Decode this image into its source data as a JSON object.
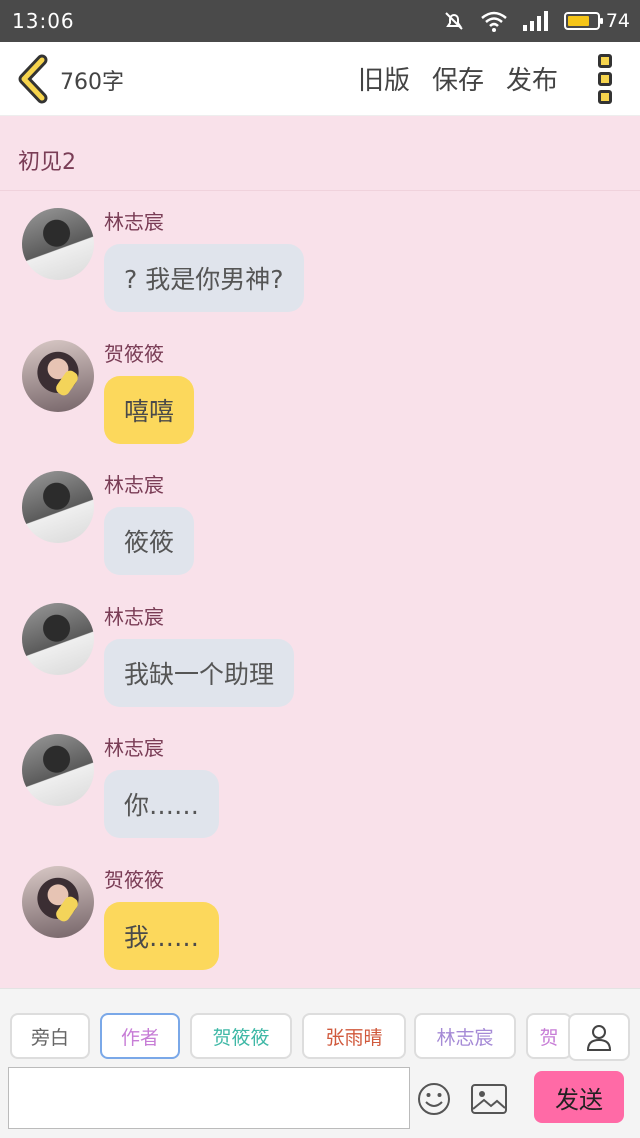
{
  "status_bar": {
    "time": "13:06",
    "battery_percent": "74",
    "battery_level": 0.74,
    "icons": [
      "mute-icon",
      "wifi-icon",
      "signal-icon",
      "battery-icon"
    ]
  },
  "header": {
    "word_count": "760字",
    "actions": {
      "old_version": "旧版",
      "save": "保存",
      "publish": "发布"
    },
    "icons": [
      "back-arrow-icon",
      "more-menu-icon"
    ]
  },
  "chat": {
    "chapter_title": "初见2",
    "messages": [
      {
        "speaker": "林志宸",
        "text": "? 我是你男神?",
        "role": "boy",
        "bubble_color": "#e0e4ec"
      },
      {
        "speaker": "贺筱筱",
        "text": "嘻嘻",
        "role": "girl",
        "bubble_color": "#fcd85c"
      },
      {
        "speaker": "林志宸",
        "text": "筱筱",
        "role": "boy",
        "bubble_color": "#e0e4ec"
      },
      {
        "speaker": "林志宸",
        "text": "我缺一个助理",
        "role": "boy",
        "bubble_color": "#e0e4ec"
      },
      {
        "speaker": "林志宸",
        "text": "你……",
        "role": "boy",
        "bubble_color": "#e0e4ec"
      },
      {
        "speaker": "贺筱筱",
        "text": "我……",
        "role": "girl",
        "bubble_color": "#fcd85c"
      }
    ]
  },
  "composer": {
    "roles": [
      {
        "label": "旁白",
        "color": "#666666"
      },
      {
        "label": "作者",
        "color": "#c77dd6",
        "selected": true
      },
      {
        "label": "贺筱筱",
        "color": "#3fb8a6"
      },
      {
        "label": "张雨晴",
        "color": "#d0593c"
      },
      {
        "label": "林志宸",
        "color": "#a58ad6"
      },
      {
        "label": "贺",
        "color": "#c77dd6"
      }
    ],
    "input_value": "",
    "send_label": "发送",
    "icons": [
      "person-icon",
      "emoji-icon",
      "image-icon"
    ]
  },
  "colors": {
    "background": "#f9e1ea",
    "status_bar": "#4a4a4a",
    "accent_send": "#ff6aa6",
    "speaker_name": "#7a3d56"
  }
}
